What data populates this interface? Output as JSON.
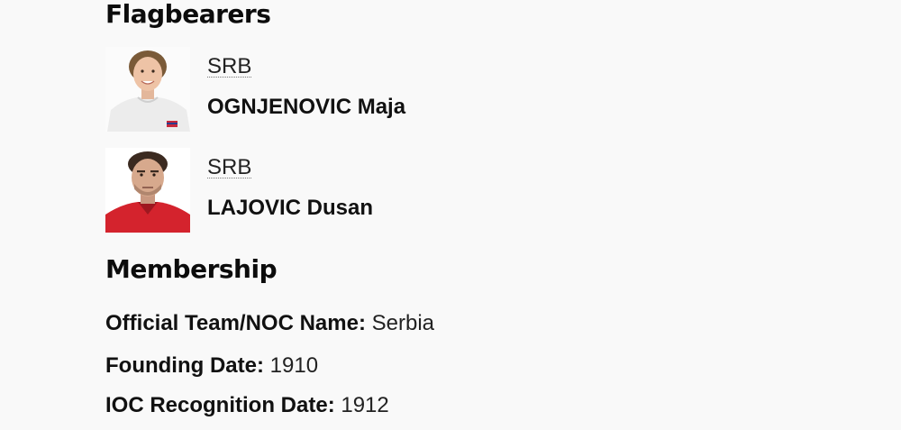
{
  "flagbearers": {
    "heading": "Flagbearers",
    "items": [
      {
        "noc": "SRB",
        "name": "OGNJENOVIC Maja"
      },
      {
        "noc": "SRB",
        "name": "LAJOVIC Dusan"
      }
    ]
  },
  "membership": {
    "heading": "Membership",
    "rows": [
      {
        "label": "Official Team/NOC Name",
        "value": "Serbia"
      },
      {
        "label": "Founding Date",
        "value": "1910"
      },
      {
        "label": "IOC Recognition Date",
        "value": "1912"
      }
    ]
  }
}
